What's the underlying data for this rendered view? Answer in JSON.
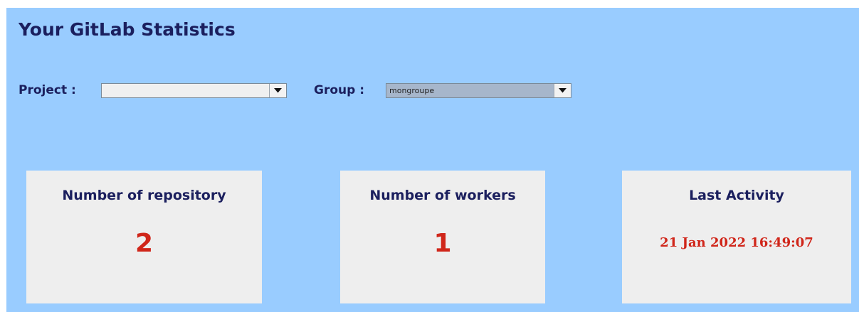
{
  "header": {
    "title": "Your GitLab Statistics"
  },
  "filters": {
    "project_label": "Project :",
    "project_value": "",
    "group_label": "Group :",
    "group_value": "mongroupe",
    "arrow_icon": "triangle-down"
  },
  "stats": {
    "repositories": {
      "label": "Number of repository",
      "value": "2"
    },
    "workers": {
      "label": "Number of workers",
      "value": "1"
    },
    "last_activity": {
      "label": "Last Activity",
      "value": "21 Jan 2022 16:49:07"
    }
  },
  "colors": {
    "background": "#99ccff",
    "card": "#eeeeee",
    "heading": "#1b1f5e",
    "value": "#d0261a",
    "group_combo": "#a6b6cb"
  }
}
